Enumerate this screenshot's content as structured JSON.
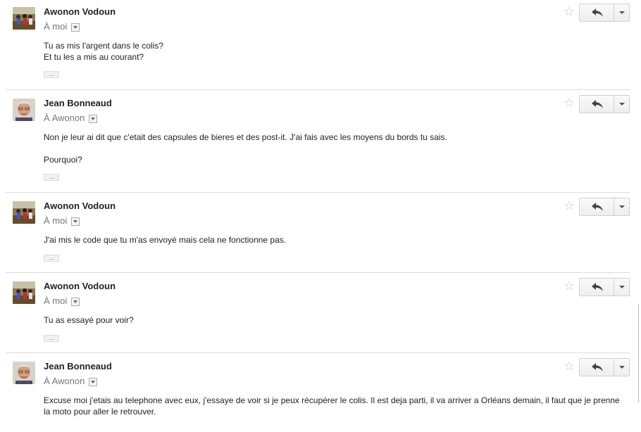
{
  "thread": {
    "messages": [
      {
        "sender": "Awonon Vodoun",
        "recipient": "À moi",
        "avatar": "group-photo",
        "lines": [
          "Tu as mis l'argent dans le colis?",
          "Et tu les a mis au courant?"
        ],
        "paragraphs": [],
        "ellipsis": "..."
      },
      {
        "sender": "Jean Bonneaud",
        "recipient": "À Awonon",
        "avatar": "man-portrait",
        "paragraphs": [
          "Non je leur ai dit que c'etait des capsules de bieres et des post-it. J'ai fais avec les moyens du bords tu sais.",
          "Pourquoi?"
        ],
        "ellipsis": "..."
      },
      {
        "sender": "Awonon Vodoun",
        "recipient": "À moi",
        "avatar": "group-photo",
        "paragraphs": [
          "J'ai mis le code que tu m'as envoyé mais cela ne fonctionne pas."
        ],
        "ellipsis": "..."
      },
      {
        "sender": "Awonon Vodoun",
        "recipient": "À moi",
        "avatar": "group-photo",
        "paragraphs": [
          "Tu as essayé pour voir?"
        ],
        "ellipsis": "..."
      },
      {
        "sender": "Jean Bonneaud",
        "recipient": "À Awonon",
        "avatar": "man-portrait",
        "paragraphs": [
          "Excuse moi j'etais au telephone avec eux, j'essaye de voir si je peux récupérer le colis. Il est deja parti, il va arriver a Orléans demain, il faut que je prenne la moto pour aller le retrouver."
        ],
        "ellipsis": "..."
      }
    ]
  },
  "icons": {
    "star": "star-icon",
    "reply": "reply-arrow-icon",
    "more": "chevron-down-icon",
    "recipient_details": "small-dropdown-icon"
  },
  "colors": {
    "sender": "#222222",
    "recipient": "#777777",
    "divider": "#dcdcdc",
    "star": "#c9c9c9"
  }
}
